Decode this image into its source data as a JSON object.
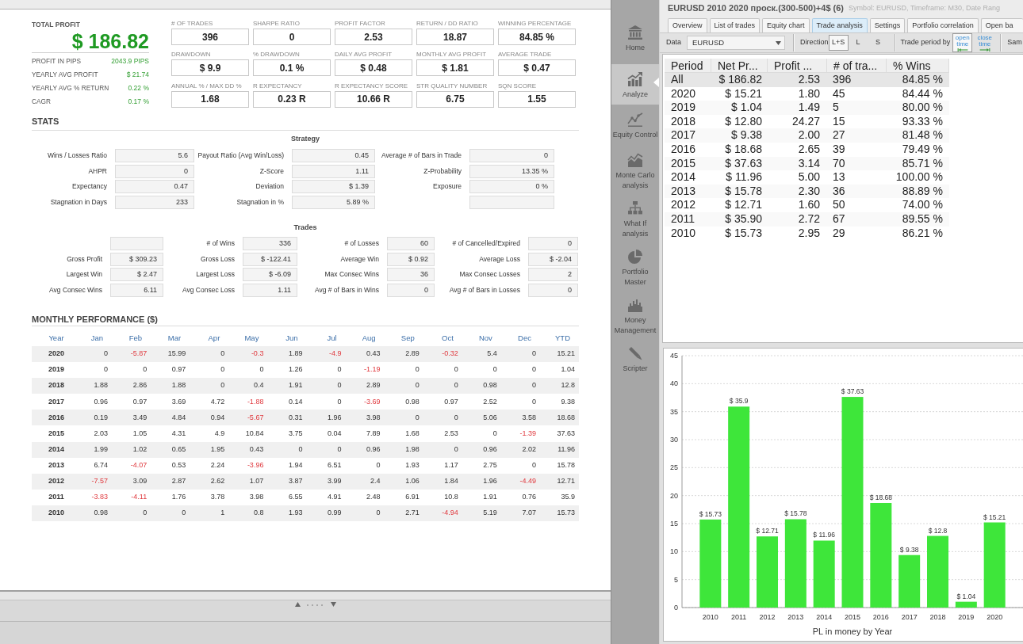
{
  "report": {
    "summary": {
      "title": "TOTAL PROFIT",
      "value": "$ 186.82",
      "rows": [
        {
          "label": "PROFIT IN PIPS",
          "value": "2043.9 PIPS"
        },
        {
          "label": "YEARLY AVG PROFIT",
          "value": "$ 21.74"
        },
        {
          "label": "YEARLY AVG % RETURN",
          "value": "0.22 %"
        },
        {
          "label": "CAGR",
          "value": "0.17 %"
        }
      ]
    },
    "metrics": [
      {
        "label": "# OF TRADES",
        "value": "396"
      },
      {
        "label": "SHARPE RATIO",
        "value": "0"
      },
      {
        "label": "PROFIT FACTOR",
        "value": "2.53"
      },
      {
        "label": "RETURN / DD RATIO",
        "value": "18.87"
      },
      {
        "label": "WINNING PERCENTAGE",
        "value": "84.85 %"
      },
      {
        "label": "DRAWDOWN",
        "value": "$ 9.9"
      },
      {
        "label": "% DRAWDOWN",
        "value": "0.1 %"
      },
      {
        "label": "DAILY AVG PROFIT",
        "value": "$ 0.48"
      },
      {
        "label": "MONTHLY AVG PROFIT",
        "value": "$ 1.81"
      },
      {
        "label": "AVERAGE TRADE",
        "value": "$ 0.47"
      },
      {
        "label": "ANNUAL % / MAX DD %",
        "value": "1.68"
      },
      {
        "label": "R EXPECTANCY",
        "value": "0.23 R"
      },
      {
        "label": "R EXPECTANCY SCORE",
        "value": "10.66 R"
      },
      {
        "label": "STR QUALITY NUMBER",
        "value": "6.75"
      },
      {
        "label": "SQN SCORE",
        "value": "1.55"
      }
    ],
    "stats": {
      "title": "STATS",
      "sections": [
        {
          "title": "Strategy",
          "rows": [
            [
              {
                "kind": "stat",
                "label": "Wins / Losses Ratio",
                "value": "5.6"
              },
              {
                "kind": "stat",
                "label": "Payout Ratio (Avg Win/Loss)",
                "value": "0.45"
              },
              {
                "kind": "stat",
                "label": "Average # of Bars in Trade",
                "value": "0"
              }
            ],
            [
              {
                "kind": "stat",
                "label": "AHPR",
                "value": "0"
              },
              {
                "kind": "stat",
                "label": "Z-Score",
                "value": "1.11"
              },
              {
                "kind": "stat",
                "label": "Z-Probability",
                "value": "13.35 %"
              }
            ],
            [
              {
                "kind": "stat",
                "label": "Expectancy",
                "value": "0.47"
              },
              {
                "kind": "stat",
                "label": "Deviation",
                "value": "$ 1.39"
              },
              {
                "kind": "stat",
                "label": "Exposure",
                "value": "0 %"
              }
            ],
            [
              {
                "kind": "stat",
                "label": "Stagnation in Days",
                "value": "233"
              },
              {
                "kind": "stat",
                "label": "Stagnation in %",
                "value": "5.89 %"
              },
              {
                "kind": "blank"
              }
            ]
          ]
        },
        {
          "title": "Trades",
          "rows": [
            [
              {
                "kind": "blank"
              },
              {
                "kind": "stat",
                "label": "# of Wins",
                "value": "336"
              },
              {
                "kind": "stat",
                "label": "# of Losses",
                "value": "60"
              },
              {
                "kind": "stat",
                "label": "# of Cancelled/Expired",
                "value": "0"
              }
            ],
            [
              {
                "kind": "stat",
                "label": "Gross Profit",
                "value": "$ 309.23"
              },
              {
                "kind": "stat",
                "label": "Gross Loss",
                "value": "$ -122.41"
              },
              {
                "kind": "stat",
                "label": "Average Win",
                "value": "$ 0.92"
              },
              {
                "kind": "stat",
                "label": "Average Loss",
                "value": "$ -2.04"
              }
            ],
            [
              {
                "kind": "stat",
                "label": "Largest Win",
                "value": "$ 2.47"
              },
              {
                "kind": "stat",
                "label": "Largest Loss",
                "value": "$ -6.09"
              },
              {
                "kind": "stat",
                "label": "Max Consec Wins",
                "value": "36"
              },
              {
                "kind": "stat",
                "label": "Max Consec Losses",
                "value": "2"
              }
            ],
            [
              {
                "kind": "stat",
                "label": "Avg Consec Wins",
                "value": "6.11"
              },
              {
                "kind": "stat",
                "label": "Avg Consec Loss",
                "value": "1.11"
              },
              {
                "kind": "stat",
                "label": "Avg # of Bars in Wins",
                "value": "0"
              },
              {
                "kind": "stat",
                "label": "Avg # of Bars in Losses",
                "value": "0"
              }
            ]
          ]
        }
      ]
    },
    "monthly": {
      "title": "MONTHLY PERFORMANCE ($)",
      "year_header": "Year",
      "columns": [
        "Jan",
        "Feb",
        "Mar",
        "Apr",
        "May",
        "Jun",
        "Jul",
        "Aug",
        "Sep",
        "Oct",
        "Nov",
        "Dec",
        "YTD"
      ],
      "rows": [
        {
          "year": "2020",
          "cells": [
            {
              "value": "0",
              "negative": false
            },
            {
              "value": "-5.87",
              "negative": true
            },
            {
              "value": "15.99",
              "negative": false
            },
            {
              "value": "0",
              "negative": false
            },
            {
              "value": "-0.3",
              "negative": true
            },
            {
              "value": "1.89",
              "negative": false
            },
            {
              "value": "-4.9",
              "negative": true
            },
            {
              "value": "0.43",
              "negative": false
            },
            {
              "value": "2.89",
              "negative": false
            },
            {
              "value": "-0.32",
              "negative": true
            },
            {
              "value": "5.4",
              "negative": false
            },
            {
              "value": "0",
              "negative": false
            },
            {
              "value": "15.21",
              "negative": false
            }
          ]
        },
        {
          "year": "2019",
          "cells": [
            {
              "value": "0",
              "negative": false
            },
            {
              "value": "0",
              "negative": false
            },
            {
              "value": "0.97",
              "negative": false
            },
            {
              "value": "0",
              "negative": false
            },
            {
              "value": "0",
              "negative": false
            },
            {
              "value": "1.26",
              "negative": false
            },
            {
              "value": "0",
              "negative": false
            },
            {
              "value": "-1.19",
              "negative": true
            },
            {
              "value": "0",
              "negative": false
            },
            {
              "value": "0",
              "negative": false
            },
            {
              "value": "0",
              "negative": false
            },
            {
              "value": "0",
              "negative": false
            },
            {
              "value": "1.04",
              "negative": false
            }
          ]
        },
        {
          "year": "2018",
          "cells": [
            {
              "value": "1.88",
              "negative": false
            },
            {
              "value": "2.86",
              "negative": false
            },
            {
              "value": "1.88",
              "negative": false
            },
            {
              "value": "0",
              "negative": false
            },
            {
              "value": "0.4",
              "negative": false
            },
            {
              "value": "1.91",
              "negative": false
            },
            {
              "value": "0",
              "negative": false
            },
            {
              "value": "2.89",
              "negative": false
            },
            {
              "value": "0",
              "negative": false
            },
            {
              "value": "0",
              "negative": false
            },
            {
              "value": "0.98",
              "negative": false
            },
            {
              "value": "0",
              "negative": false
            },
            {
              "value": "12.8",
              "negative": false
            }
          ]
        },
        {
          "year": "2017",
          "cells": [
            {
              "value": "0.96",
              "negative": false
            },
            {
              "value": "0.97",
              "negative": false
            },
            {
              "value": "3.69",
              "negative": false
            },
            {
              "value": "4.72",
              "negative": false
            },
            {
              "value": "-1.88",
              "negative": true
            },
            {
              "value": "0.14",
              "negative": false
            },
            {
              "value": "0",
              "negative": false
            },
            {
              "value": "-3.69",
              "negative": true
            },
            {
              "value": "0.98",
              "negative": false
            },
            {
              "value": "0.97",
              "negative": false
            },
            {
              "value": "2.52",
              "negative": false
            },
            {
              "value": "0",
              "negative": false
            },
            {
              "value": "9.38",
              "negative": false
            }
          ]
        },
        {
          "year": "2016",
          "cells": [
            {
              "value": "0.19",
              "negative": false
            },
            {
              "value": "3.49",
              "negative": false
            },
            {
              "value": "4.84",
              "negative": false
            },
            {
              "value": "0.94",
              "negative": false
            },
            {
              "value": "-5.67",
              "negative": true
            },
            {
              "value": "0.31",
              "negative": false
            },
            {
              "value": "1.96",
              "negative": false
            },
            {
              "value": "3.98",
              "negative": false
            },
            {
              "value": "0",
              "negative": false
            },
            {
              "value": "0",
              "negative": false
            },
            {
              "value": "5.06",
              "negative": false
            },
            {
              "value": "3.58",
              "negative": false
            },
            {
              "value": "18.68",
              "negative": false
            }
          ]
        },
        {
          "year": "2015",
          "cells": [
            {
              "value": "2.03",
              "negative": false
            },
            {
              "value": "1.05",
              "negative": false
            },
            {
              "value": "4.31",
              "negative": false
            },
            {
              "value": "4.9",
              "negative": false
            },
            {
              "value": "10.84",
              "negative": false
            },
            {
              "value": "3.75",
              "negative": false
            },
            {
              "value": "0.04",
              "negative": false
            },
            {
              "value": "7.89",
              "negative": false
            },
            {
              "value": "1.68",
              "negative": false
            },
            {
              "value": "2.53",
              "negative": false
            },
            {
              "value": "0",
              "negative": false
            },
            {
              "value": "-1.39",
              "negative": true
            },
            {
              "value": "37.63",
              "negative": false
            }
          ]
        },
        {
          "year": "2014",
          "cells": [
            {
              "value": "1.99",
              "negative": false
            },
            {
              "value": "1.02",
              "negative": false
            },
            {
              "value": "0.65",
              "negative": false
            },
            {
              "value": "1.95",
              "negative": false
            },
            {
              "value": "0.43",
              "negative": false
            },
            {
              "value": "0",
              "negative": false
            },
            {
              "value": "0",
              "negative": false
            },
            {
              "value": "0.96",
              "negative": false
            },
            {
              "value": "1.98",
              "negative": false
            },
            {
              "value": "0",
              "negative": false
            },
            {
              "value": "0.96",
              "negative": false
            },
            {
              "value": "2.02",
              "negative": false
            },
            {
              "value": "11.96",
              "negative": false
            }
          ]
        },
        {
          "year": "2013",
          "cells": [
            {
              "value": "6.74",
              "negative": false
            },
            {
              "value": "-4.07",
              "negative": true
            },
            {
              "value": "0.53",
              "negative": false
            },
            {
              "value": "2.24",
              "negative": false
            },
            {
              "value": "-3.96",
              "negative": true
            },
            {
              "value": "1.94",
              "negative": false
            },
            {
              "value": "6.51",
              "negative": false
            },
            {
              "value": "0",
              "negative": false
            },
            {
              "value": "1.93",
              "negative": false
            },
            {
              "value": "1.17",
              "negative": false
            },
            {
              "value": "2.75",
              "negative": false
            },
            {
              "value": "0",
              "negative": false
            },
            {
              "value": "15.78",
              "negative": false
            }
          ]
        },
        {
          "year": "2012",
          "cells": [
            {
              "value": "-7.57",
              "negative": true
            },
            {
              "value": "3.09",
              "negative": false
            },
            {
              "value": "2.87",
              "negative": false
            },
            {
              "value": "2.62",
              "negative": false
            },
            {
              "value": "1.07",
              "negative": false
            },
            {
              "value": "3.87",
              "negative": false
            },
            {
              "value": "3.99",
              "negative": false
            },
            {
              "value": "2.4",
              "negative": false
            },
            {
              "value": "1.06",
              "negative": false
            },
            {
              "value": "1.84",
              "negative": false
            },
            {
              "value": "1.96",
              "negative": false
            },
            {
              "value": "-4.49",
              "negative": true
            },
            {
              "value": "12.71",
              "negative": false
            }
          ]
        },
        {
          "year": "2011",
          "cells": [
            {
              "value": "-3.83",
              "negative": true
            },
            {
              "value": "-4.11",
              "negative": true
            },
            {
              "value": "1.76",
              "negative": false
            },
            {
              "value": "3.78",
              "negative": false
            },
            {
              "value": "3.98",
              "negative": false
            },
            {
              "value": "6.55",
              "negative": false
            },
            {
              "value": "4.91",
              "negative": false
            },
            {
              "value": "2.48",
              "negative": false
            },
            {
              "value": "6.91",
              "negative": false
            },
            {
              "value": "10.8",
              "negative": false
            },
            {
              "value": "1.91",
              "negative": false
            },
            {
              "value": "0.76",
              "negative": false
            },
            {
              "value": "35.9",
              "negative": false
            }
          ]
        },
        {
          "year": "2010",
          "cells": [
            {
              "value": "0.98",
              "negative": false
            },
            {
              "value": "0",
              "negative": false
            },
            {
              "value": "0",
              "negative": false
            },
            {
              "value": "1",
              "negative": false
            },
            {
              "value": "0.8",
              "negative": false
            },
            {
              "value": "1.93",
              "negative": false
            },
            {
              "value": "0.99",
              "negative": false
            },
            {
              "value": "0",
              "negative": false
            },
            {
              "value": "2.71",
              "negative": false
            },
            {
              "value": "-4.94",
              "negative": true
            },
            {
              "value": "5.19",
              "negative": false
            },
            {
              "value": "7.07",
              "negative": false
            },
            {
              "value": "15.73",
              "negative": false
            }
          ]
        }
      ]
    }
  },
  "sidebar": {
    "items": [
      {
        "label": "Home",
        "selected": false
      },
      {
        "label": "Analyze",
        "selected": true
      },
      {
        "label": "Equity Control",
        "selected": false
      },
      {
        "label": "Monte Carlo analysis",
        "selected": false
      },
      {
        "label": "What If analysis",
        "selected": false
      },
      {
        "label": "Portfolio Master",
        "selected": false
      },
      {
        "label": "Money Management",
        "selected": false
      },
      {
        "label": "Scripter",
        "selected": false
      }
    ]
  },
  "window": {
    "title": "EURUSD 2010 2020 проск.(300-500)+4$ (6)",
    "subtitle": "Symbol: EURUSD, Timeframe: M30, Date Rang"
  },
  "tabs": [
    {
      "label": "Overview",
      "selected": false
    },
    {
      "label": "List of trades",
      "selected": false
    },
    {
      "label": "Equity chart",
      "selected": false
    },
    {
      "label": "Trade analysis",
      "selected": true
    },
    {
      "label": "Settings",
      "selected": false
    },
    {
      "label": "Portfolio correlation",
      "selected": false
    },
    {
      "label": "Open ba",
      "selected": false
    }
  ],
  "toolbar": {
    "data": {
      "label": "Data",
      "value": "EURUSD"
    },
    "direction": {
      "label": "Direction",
      "options": [
        {
          "label": "L+S",
          "selected": true
        },
        {
          "label": "L",
          "selected": false
        },
        {
          "label": "S",
          "selected": false
        }
      ]
    },
    "trade_period": {
      "label": "Trade period by",
      "options": [
        {
          "label": "open time",
          "selected": true
        },
        {
          "label": "close time",
          "selected": false
        }
      ]
    },
    "sample": {
      "label": "Sam"
    }
  },
  "trade_analysis_table": {
    "columns": [
      "Period",
      "Net Pr...",
      "Profit ...",
      "# of tra...",
      "% Wins"
    ],
    "rows": [
      {
        "cells": [
          "All",
          "$ 186.82",
          "2.53",
          "396",
          "84.85 %"
        ],
        "selected": true
      },
      {
        "cells": [
          "2020",
          "$ 15.21",
          "1.80",
          "45",
          "84.44 %"
        ],
        "selected": false
      },
      {
        "cells": [
          "2019",
          "$ 1.04",
          "1.49",
          "5",
          "80.00 %"
        ],
        "selected": false
      },
      {
        "cells": [
          "2018",
          "$ 12.80",
          "24.27",
          "15",
          "93.33 %"
        ],
        "selected": false
      },
      {
        "cells": [
          "2017",
          "$ 9.38",
          "2.00",
          "27",
          "81.48 %"
        ],
        "selected": false
      },
      {
        "cells": [
          "2016",
          "$ 18.68",
          "2.65",
          "39",
          "79.49 %"
        ],
        "selected": false
      },
      {
        "cells": [
          "2015",
          "$ 37.63",
          "3.14",
          "70",
          "85.71 %"
        ],
        "selected": false
      },
      {
        "cells": [
          "2014",
          "$ 11.96",
          "5.00",
          "13",
          "100.00 %"
        ],
        "selected": false
      },
      {
        "cells": [
          "2013",
          "$ 15.78",
          "2.30",
          "36",
          "88.89 %"
        ],
        "selected": false
      },
      {
        "cells": [
          "2012",
          "$ 12.71",
          "1.60",
          "50",
          "74.00 %"
        ],
        "selected": false
      },
      {
        "cells": [
          "2011",
          "$ 35.90",
          "2.72",
          "67",
          "89.55 %"
        ],
        "selected": false
      },
      {
        "cells": [
          "2010",
          "$ 15.73",
          "2.95",
          "29",
          "86.21 %"
        ],
        "selected": false
      }
    ]
  },
  "chart_panel": {
    "chart_data": [
      {
        "type": "bar",
        "xlabel": "PL in money by Year",
        "categories": [
          "2010",
          "2011",
          "2012",
          "2013",
          "2014",
          "2015",
          "2016",
          "2017",
          "2018",
          "2019",
          "2020"
        ],
        "values": [
          15.73,
          35.9,
          12.71,
          15.78,
          11.96,
          37.63,
          18.68,
          9.38,
          12.8,
          1.04,
          15.21
        ],
        "color": "#3ee63a",
        "ylim": [
          0,
          45
        ],
        "yticks": [
          0,
          5,
          10,
          15,
          20,
          25,
          30,
          35,
          40,
          45
        ],
        "grid": "y",
        "value_labels": [
          "$ 15.73",
          "$ 35.9",
          "$ 12.71",
          "$ 15.78",
          "$ 11.96",
          "$ 37.63",
          "$ 18.68",
          "$ 9.38",
          "$ 12.8",
          "$ 1.04",
          "$ 15.21"
        ]
      }
    ]
  }
}
